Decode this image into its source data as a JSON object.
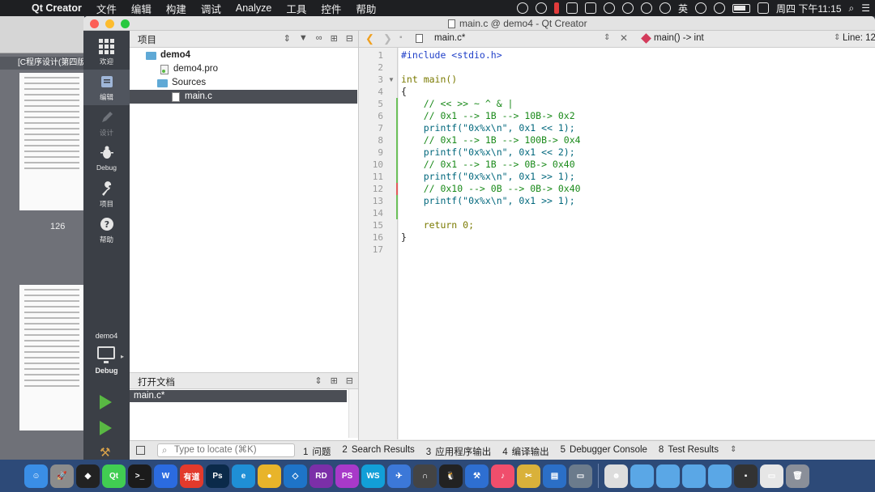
{
  "menubar": {
    "app_name": "Qt Creator",
    "items": [
      "文件",
      "编辑",
      "构建",
      "调试",
      "Analyze",
      "工具",
      "控件",
      "帮助"
    ],
    "input_method": "英",
    "clock": "周四 下午11:15"
  },
  "background_window": {
    "doc_title": "[C程序设计(第四版",
    "page_number": "126"
  },
  "window": {
    "title": "main.c @ demo4 - Qt Creator"
  },
  "modes": [
    {
      "label": "欢迎",
      "icon": "welcome-grid-icon"
    },
    {
      "label": "编辑",
      "icon": "edit-icon"
    },
    {
      "label": "设计",
      "icon": "design-pen-icon"
    },
    {
      "label": "Debug",
      "icon": "debug-bug-icon"
    },
    {
      "label": "项目",
      "icon": "projects-wrench-icon"
    },
    {
      "label": "帮助",
      "icon": "help-icon"
    }
  ],
  "kit": {
    "project": "demo4",
    "build_config": "Debug"
  },
  "projects_panel": {
    "title": "项目",
    "tree": [
      {
        "label": "demo4",
        "type": "project"
      },
      {
        "label": "demo4.pro",
        "type": "pro-file"
      },
      {
        "label": "Sources",
        "type": "folder"
      },
      {
        "label": "main.c",
        "type": "c-file"
      }
    ]
  },
  "open_documents": {
    "title": "打开文档",
    "items": [
      "main.c*"
    ]
  },
  "editor": {
    "file_tab": "main.c*",
    "symbol": "main() -> int",
    "line_col": "Line: 12",
    "line_numbers": [
      "1",
      "2",
      "3",
      "4",
      "5",
      "6",
      "7",
      "8",
      "9",
      "10",
      "11",
      "12",
      "13",
      "14",
      "15",
      "16",
      "17"
    ],
    "lines": [
      "#include <stdio.h>",
      "",
      "int main()",
      "{",
      "    // << >> ~ ^ & |",
      "    // 0x1 --> 1B --> 10B-> 0x2",
      "    printf(\"0x%x\\n\", 0x1 << 1);",
      "    // 0x1 --> 1B --> 100B-> 0x4",
      "    printf(\"0x%x\\n\", 0x1 << 2);",
      "    // 0x1 --> 1B --> 0B-> 0x40",
      "    printf(\"0x%x\\n\", 0x1 >> 1);",
      "    // 0x10 --> 0B --> 0B-> 0x40",
      "    printf(\"0x%x\\n\", 0x1 >> 1);",
      "",
      "    return 0;",
      "}",
      ""
    ]
  },
  "statusbar": {
    "locate_placeholder": "Type to locate (⌘K)",
    "panes": [
      {
        "num": "1",
        "label": "问题"
      },
      {
        "num": "2",
        "label": "Search Results"
      },
      {
        "num": "3",
        "label": "应用程序输出"
      },
      {
        "num": "4",
        "label": "编译输出"
      },
      {
        "num": "5",
        "label": "Debugger Console"
      },
      {
        "num": "8",
        "label": "Test Results"
      }
    ]
  },
  "dock": [
    {
      "name": "finder",
      "color": "#3a8ee6",
      "glyph": "☺"
    },
    {
      "name": "launchpad",
      "color": "#8c8c8c",
      "glyph": "🚀"
    },
    {
      "name": "unity",
      "color": "#222222",
      "glyph": "◆"
    },
    {
      "name": "qt-creator",
      "color": "#41cd52",
      "glyph": "Qt"
    },
    {
      "name": "terminal",
      "color": "#1b1b1b",
      "glyph": ">_"
    },
    {
      "name": "wps",
      "color": "#2b6be0",
      "glyph": "W"
    },
    {
      "name": "youdao",
      "color": "#e23a2c",
      "glyph": "有道"
    },
    {
      "name": "photoshop",
      "color": "#0b2a4a",
      "glyph": "Ps"
    },
    {
      "name": "edge",
      "color": "#1f8fd6",
      "glyph": "e"
    },
    {
      "name": "chrome",
      "color": "#e8b42a",
      "glyph": "●"
    },
    {
      "name": "vscode",
      "color": "#1e74c8",
      "glyph": "◇"
    },
    {
      "name": "rider",
      "color": "#7b2fa8",
      "glyph": "RD"
    },
    {
      "name": "phpstorm",
      "color": "#a839c9",
      "glyph": "PS"
    },
    {
      "name": "webstorm",
      "color": "#129fd8",
      "glyph": "WS"
    },
    {
      "name": "feishu",
      "color": "#3c78d8",
      "glyph": "✈"
    },
    {
      "name": "tunnel",
      "color": "#444444",
      "glyph": "∩"
    },
    {
      "name": "qq",
      "color": "#222222",
      "glyph": "🐧"
    },
    {
      "name": "xcode-tools",
      "color": "#2e6fd1",
      "glyph": "⚒"
    },
    {
      "name": "music",
      "color": "#f04e6c",
      "glyph": "♪"
    },
    {
      "name": "scissors",
      "color": "#d9b13a",
      "glyph": "✂"
    },
    {
      "name": "instruments",
      "color": "#2b6fc7",
      "glyph": "▤"
    },
    {
      "name": "display",
      "color": "#6b7b8c",
      "glyph": "▭"
    },
    {
      "name": "photo",
      "color": "#dddddd",
      "glyph": "☻"
    },
    {
      "name": "folder-1",
      "color": "#5aa7e6",
      "glyph": ""
    },
    {
      "name": "folder-2",
      "color": "#5aa7e6",
      "glyph": ""
    },
    {
      "name": "folder-3",
      "color": "#5aa7e6",
      "glyph": ""
    },
    {
      "name": "folder-4",
      "color": "#5aa7e6",
      "glyph": ""
    },
    {
      "name": "screen-recorder",
      "color": "#333333",
      "glyph": "▪"
    },
    {
      "name": "preview",
      "color": "#e6e6e6",
      "glyph": "▭"
    },
    {
      "name": "trash",
      "color": "#8a8f99",
      "glyph": "🗑"
    }
  ]
}
